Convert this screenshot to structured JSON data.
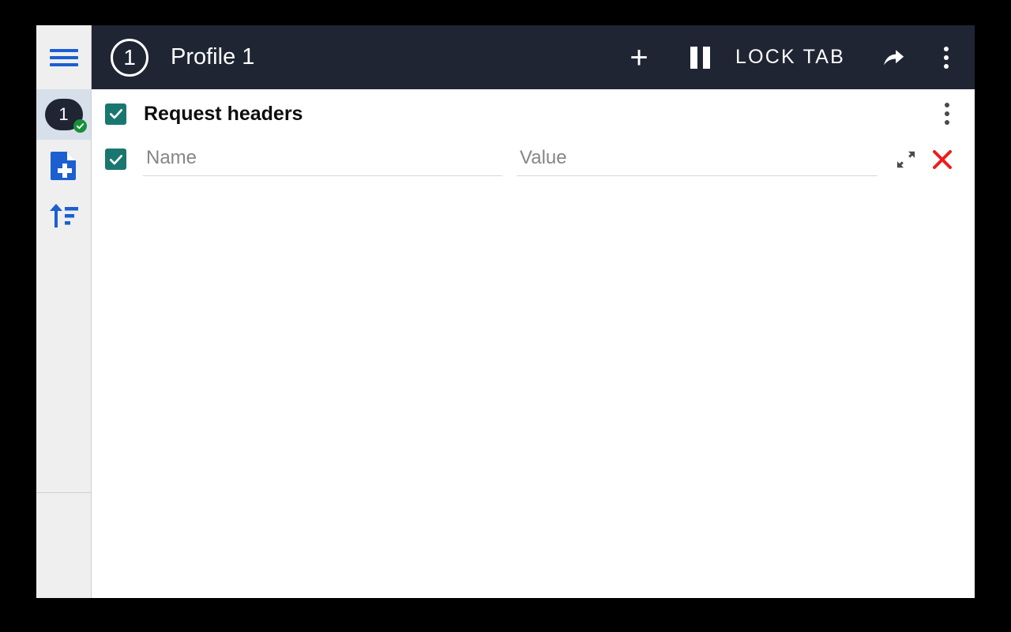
{
  "window": {
    "background": "#ffffff",
    "outer_background": "#000000"
  },
  "titlebar": {
    "background": "#1f2533",
    "profile_number": "1",
    "title": "Profile 1",
    "add_label": "+",
    "lock_tab_label": "LOCK TAB",
    "icons": {
      "menu": "hamburger-icon",
      "add": "plus-icon",
      "pause": "pause-icon",
      "share": "share-arrow-icon",
      "overflow": "more-vertical-icon"
    }
  },
  "side_rail": {
    "background": "#efefef",
    "active_background": "#d7dfea",
    "items": [
      {
        "name": "profile-1",
        "label": "1",
        "badge": "enabled-check",
        "badge_color": "#18903a",
        "active": true
      },
      {
        "name": "new-profile",
        "label": "",
        "icon": "document-plus-icon",
        "icon_color": "#1b5fd0",
        "active": false
      },
      {
        "name": "sort-profiles",
        "label": "",
        "icon": "sort-ascending-icon",
        "icon_color": "#1b5fd0",
        "active": false
      }
    ]
  },
  "main": {
    "section": {
      "title": "Request headers",
      "checkbox_checked": true,
      "checkbox_color": "#1a7770",
      "overflow_icon": "more-vertical-icon"
    },
    "rows": [
      {
        "checkbox_checked": true,
        "name_value": "",
        "name_placeholder": "Name",
        "value_value": "",
        "value_placeholder": "Value",
        "expand_icon": "expand-diagonal-icon",
        "delete_icon": "close-x-icon",
        "delete_color": "#ee1c1c"
      }
    ]
  }
}
